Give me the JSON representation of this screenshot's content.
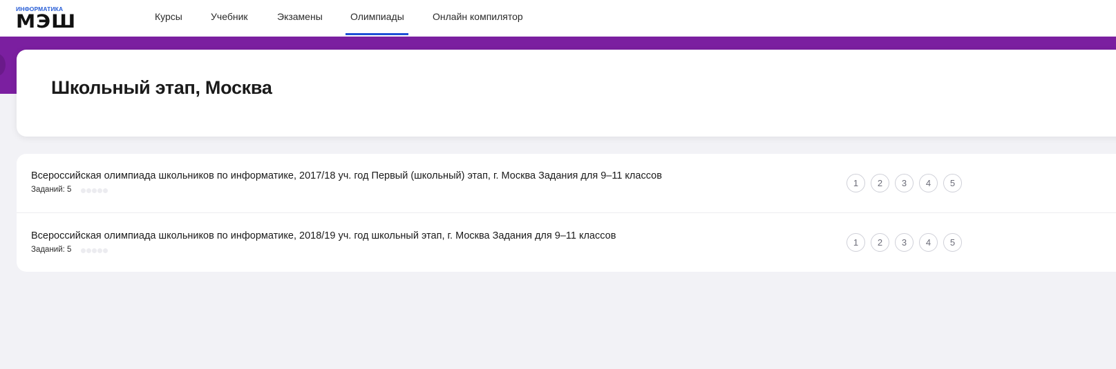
{
  "logo": {
    "small": "ИНФОРМАТИКА",
    "big": "МЭШ"
  },
  "nav": {
    "items": [
      {
        "label": "Курсы"
      },
      {
        "label": "Учебник"
      },
      {
        "label": "Экзамены"
      },
      {
        "label": "Олимпиады",
        "active": true
      },
      {
        "label": "Онлайн компилятор"
      }
    ]
  },
  "colors": {
    "band": "#7b1fa0",
    "accent": "#1f4fd6",
    "background": "#f2f2f6"
  },
  "page_title": "Школьный этап, Москва",
  "olympiads": [
    {
      "title": "Всероссийская олимпиада школьников по информатике, 2017/18 уч. год Первый (школьный) этап, г. Москва Задания для 9–11 классов",
      "count_label": "Заданий: 5",
      "tasks": [
        "1",
        "2",
        "3",
        "4",
        "5"
      ]
    },
    {
      "title": "Всероссийская олимпиада школьников по информатике, 2018/19 уч. год школьный этап, г. Москва Задания для 9–11 классов",
      "count_label": "Заданий: 5",
      "tasks": [
        "1",
        "2",
        "3",
        "4",
        "5"
      ]
    }
  ]
}
